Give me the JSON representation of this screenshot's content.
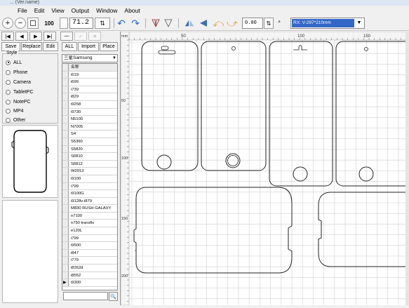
{
  "window": {
    "title": "... (Ver.name)"
  },
  "menu": [
    "File",
    "Edit",
    "View",
    "Output",
    "Window",
    "About"
  ],
  "toolbar": {
    "zoom_value": "71.2",
    "size_field": "0.00",
    "size_unit": "100",
    "device_select": "RX: V-297*210mm"
  },
  "nav_buttons": [
    "|◀",
    "◀",
    "▶",
    "▶|",
    "—",
    "✓",
    "✕"
  ],
  "action_buttons": [
    "Save",
    "Replace",
    "Edit",
    "ALL",
    "Import",
    "Place"
  ],
  "style": {
    "legend": "Style",
    "options": [
      "ALL",
      "Phone",
      "Camera",
      "TabletPC",
      "NotePC",
      "MP4",
      "Other"
    ],
    "selected": "ALL"
  },
  "brand_select": "三星Samsung",
  "model_list": {
    "header": "名称",
    "items": [
      "i619",
      "i699",
      "i739",
      "i829",
      "i9258",
      "i9730",
      "N5100",
      "N7005",
      "S4",
      "S5360",
      "S5820",
      "S6810",
      "S6812",
      "W2013",
      "i9100",
      "i799",
      "i9100G",
      "i9128v-i879",
      "M830 RUSH GALAXY",
      "n7100",
      "n750 transfix",
      "e120L",
      "i799",
      "i9500",
      "i847",
      "i779",
      "i8262d",
      "i8552",
      "i9300"
    ],
    "current_index": 28
  },
  "ruler": {
    "h_ticks": [
      "0",
      "50",
      "100",
      "150"
    ],
    "v_ticks": [
      "50",
      "100",
      "150",
      "200"
    ],
    "unit": "mm"
  },
  "colors": {
    "accent": "#3367c8",
    "grid": "#cfcfcf",
    "outline": "#222222"
  }
}
